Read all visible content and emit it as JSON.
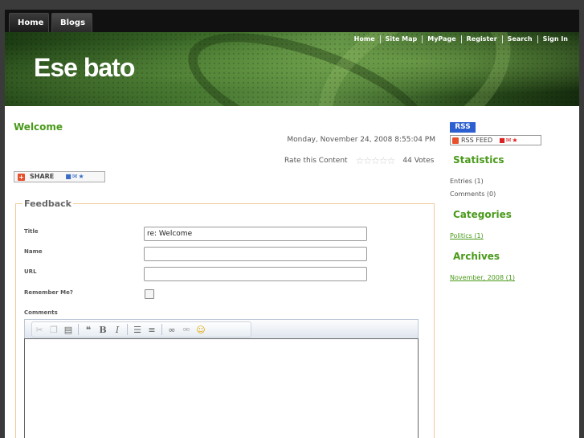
{
  "tabs": {
    "home": "Home",
    "blogs": "Blogs"
  },
  "nav": [
    "Home",
    "Site Map",
    "MyPage",
    "Register",
    "Search",
    "Sign In"
  ],
  "site": {
    "title": "Ese bato"
  },
  "post": {
    "title": "Welcome",
    "date": "Monday, November 24, 2008 8:55:04 PM",
    "rate_label": "Rate this Content",
    "votes": "44 Votes",
    "rating": 0,
    "share_label": "SHARE"
  },
  "feedback": {
    "legend": "Feedback",
    "title_label": "Title",
    "title_value": "re: Welcome",
    "name_label": "Name",
    "url_label": "URL",
    "remember_label": "Remember Me?",
    "comments_label": "Comments"
  },
  "sidebar": {
    "rss": "RSS",
    "rss_feed": "RSS FEED",
    "statistics_heading": "Statistics",
    "entries": "Entries (1)",
    "comments": "Comments (0)",
    "categories_heading": "Categories",
    "category": "Politics (1)",
    "archives_heading": "Archives",
    "archive": "November, 2008 (1)"
  },
  "colors": {
    "accent": "#4a9a1a",
    "rss": "#2c5fcf"
  }
}
